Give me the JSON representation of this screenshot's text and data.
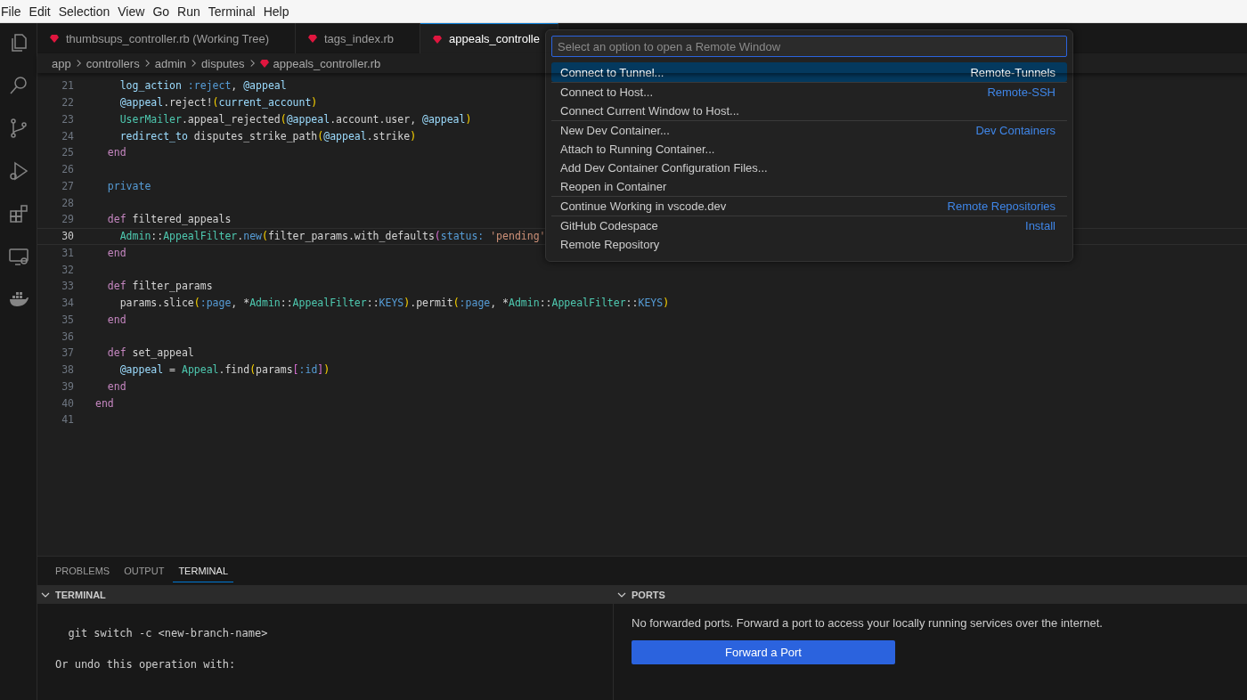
{
  "menu_bar": [
    "File",
    "Edit",
    "Selection",
    "View",
    "Go",
    "Run",
    "Terminal",
    "Help"
  ],
  "activity_bar": [
    {
      "kind": "files"
    },
    {
      "kind": "search"
    },
    {
      "kind": "source-control"
    },
    {
      "kind": "run-debug"
    },
    {
      "kind": "extensions"
    },
    {
      "kind": "remote"
    },
    {
      "kind": "docker"
    }
  ],
  "tabs": [
    {
      "label": "thumbsups_controller.rb (Working Tree)",
      "selected": false
    },
    {
      "label": "tags_index.rb",
      "selected": false
    },
    {
      "label": "appeals_controlle",
      "selected": true
    }
  ],
  "breadcrumb": [
    "app",
    "controllers",
    "admin",
    "disputes",
    "appeals_controller.rb"
  ],
  "editor": {
    "lines": [
      {
        "number": "21",
        "current": false,
        "tokens": [
          {
            "kind": "fn",
            "t": "    log_action"
          },
          {
            "kind": "sym",
            "t": " :reject"
          },
          {
            "kind": "plain",
            "t": ", "
          },
          {
            "kind": "ivar",
            "t": "@appeal"
          }
        ]
      },
      {
        "number": "22",
        "current": false,
        "tokens": [
          {
            "kind": "ivar",
            "t": "    @appeal"
          },
          {
            "kind": "plain",
            "t": ".reject!"
          },
          {
            "kind": "b1",
            "t": "("
          },
          {
            "kind": "ivar",
            "t": "current_account"
          },
          {
            "kind": "b1",
            "t": ")"
          }
        ]
      },
      {
        "number": "23",
        "current": false,
        "tokens": [
          {
            "kind": "const",
            "t": "    UserMailer"
          },
          {
            "kind": "plain",
            "t": ".appeal_rejected"
          },
          {
            "kind": "b1",
            "t": "("
          },
          {
            "kind": "ivar",
            "t": "@appeal"
          },
          {
            "kind": "plain",
            "t": ".account.user, "
          },
          {
            "kind": "ivar",
            "t": "@appeal"
          },
          {
            "kind": "b1",
            "t": ")"
          }
        ]
      },
      {
        "number": "24",
        "current": false,
        "tokens": [
          {
            "kind": "fn",
            "t": "    redirect_to"
          },
          {
            "kind": "plain",
            "t": " disputes_strike_path"
          },
          {
            "kind": "b1",
            "t": "("
          },
          {
            "kind": "ivar",
            "t": "@appeal"
          },
          {
            "kind": "plain",
            "t": ".strike"
          },
          {
            "kind": "b1",
            "t": ")"
          }
        ]
      },
      {
        "number": "25",
        "current": false,
        "tokens": [
          {
            "kind": "kw",
            "t": "  end"
          }
        ]
      },
      {
        "number": "26",
        "current": false
      },
      {
        "number": "27",
        "current": false,
        "tokens": [
          {
            "kind": "sym",
            "t": "  private"
          }
        ]
      },
      {
        "number": "28",
        "current": false
      },
      {
        "number": "29",
        "current": false,
        "tokens": [
          {
            "kind": "kw",
            "t": "  def"
          },
          {
            "kind": "plain",
            "t": " filtered_appeals"
          }
        ]
      },
      {
        "number": "30",
        "current": true,
        "tokens": [
          {
            "kind": "const",
            "t": "    Admin"
          },
          {
            "kind": "plain",
            "t": "::"
          },
          {
            "kind": "const",
            "t": "AppealFilter"
          },
          {
            "kind": "plain",
            "t": "."
          },
          {
            "kind": "sym",
            "t": "new"
          },
          {
            "kind": "b1",
            "t": "("
          },
          {
            "kind": "plain",
            "t": "filter_params.with_defaults"
          },
          {
            "kind": "b2",
            "t": "("
          },
          {
            "kind": "sym",
            "t": "status:"
          },
          {
            "kind": "str",
            "t": " 'pending'"
          }
        ]
      },
      {
        "number": "31",
        "current": false,
        "tokens": [
          {
            "kind": "kw",
            "t": "  end"
          }
        ]
      },
      {
        "number": "32",
        "current": false
      },
      {
        "number": "33",
        "current": false,
        "tokens": [
          {
            "kind": "kw",
            "t": "  def"
          },
          {
            "kind": "plain",
            "t": " filter_params"
          }
        ]
      },
      {
        "number": "34",
        "current": false,
        "tokens": [
          {
            "kind": "plain",
            "t": "    params.slice"
          },
          {
            "kind": "b1",
            "t": "("
          },
          {
            "kind": "sym",
            "t": ":page"
          },
          {
            "kind": "plain",
            "t": ", *"
          },
          {
            "kind": "const",
            "t": "Admin"
          },
          {
            "kind": "plain",
            "t": "::"
          },
          {
            "kind": "const",
            "t": "AppealFilter"
          },
          {
            "kind": "plain",
            "t": "::"
          },
          {
            "kind": "sym",
            "t": "KEYS"
          },
          {
            "kind": "b1",
            "t": ")"
          },
          {
            "kind": "plain",
            "t": ".permit"
          },
          {
            "kind": "b1",
            "t": "("
          },
          {
            "kind": "sym",
            "t": ":page"
          },
          {
            "kind": "plain",
            "t": ", *"
          },
          {
            "kind": "const",
            "t": "Admin"
          },
          {
            "kind": "plain",
            "t": "::"
          },
          {
            "kind": "const",
            "t": "AppealFilter"
          },
          {
            "kind": "plain",
            "t": "::"
          },
          {
            "kind": "sym",
            "t": "KEYS"
          },
          {
            "kind": "b1",
            "t": ")"
          }
        ]
      },
      {
        "number": "35",
        "current": false,
        "tokens": [
          {
            "kind": "kw",
            "t": "  end"
          }
        ]
      },
      {
        "number": "36",
        "current": false
      },
      {
        "number": "37",
        "current": false,
        "tokens": [
          {
            "kind": "kw",
            "t": "  def"
          },
          {
            "kind": "plain",
            "t": " set_appeal"
          }
        ]
      },
      {
        "number": "38",
        "current": false,
        "tokens": [
          {
            "kind": "ivar",
            "t": "    @appeal"
          },
          {
            "kind": "plain",
            "t": " = "
          },
          {
            "kind": "const",
            "t": "Appeal"
          },
          {
            "kind": "plain",
            "t": ".find"
          },
          {
            "kind": "b1",
            "t": "("
          },
          {
            "kind": "plain",
            "t": "params"
          },
          {
            "kind": "b2",
            "t": "["
          },
          {
            "kind": "sym",
            "t": ":id"
          },
          {
            "kind": "b2",
            "t": "]"
          },
          {
            "kind": "b1",
            "t": ")"
          }
        ]
      },
      {
        "number": "39",
        "current": false,
        "tokens": [
          {
            "kind": "kw",
            "t": "  end"
          }
        ]
      },
      {
        "number": "40",
        "current": false,
        "tokens": [
          {
            "kind": "kw",
            "t": "end"
          }
        ]
      },
      {
        "number": "41",
        "current": false
      }
    ]
  },
  "quick_pick": {
    "placeholder": "Select an option to open a Remote Window",
    "items": [
      {
        "label": "Connect to Tunnel...",
        "detail": "Remote-Tunnels",
        "selected": true,
        "separator": false
      },
      {
        "label": "Connect to Host...",
        "detail": "Remote-SSH",
        "selected": false,
        "separator": true
      },
      {
        "label": "Connect Current Window to Host...",
        "selected": false,
        "separator": false
      },
      {
        "label": "New Dev Container...",
        "detail": "Dev Containers",
        "selected": false,
        "separator": true
      },
      {
        "label": "Attach to Running Container...",
        "selected": false,
        "separator": false
      },
      {
        "label": "Add Dev Container Configuration Files...",
        "selected": false,
        "separator": false
      },
      {
        "label": "Reopen in Container",
        "selected": false,
        "separator": false
      },
      {
        "label": "Continue Working in vscode.dev",
        "detail": "Remote Repositories",
        "selected": false,
        "separator": true
      },
      {
        "label": "GitHub Codespace",
        "detail": "Install",
        "selected": false,
        "separator": true
      },
      {
        "label": "Remote Repository",
        "selected": false,
        "separator": false
      }
    ]
  },
  "panel": {
    "tabs": [
      {
        "label": "PROBLEMS",
        "selected": false
      },
      {
        "label": "OUTPUT",
        "selected": false
      },
      {
        "label": "TERMINAL",
        "selected": true
      }
    ],
    "terminal": {
      "title": "TERMINAL",
      "lines": [
        "  git switch -c <new-branch-name>",
        "Or undo this operation with:"
      ]
    },
    "ports": {
      "title": "PORTS",
      "message": "No forwarded ports. Forward a port to access your locally running services over the internet.",
      "button": "Forward a Port"
    }
  }
}
